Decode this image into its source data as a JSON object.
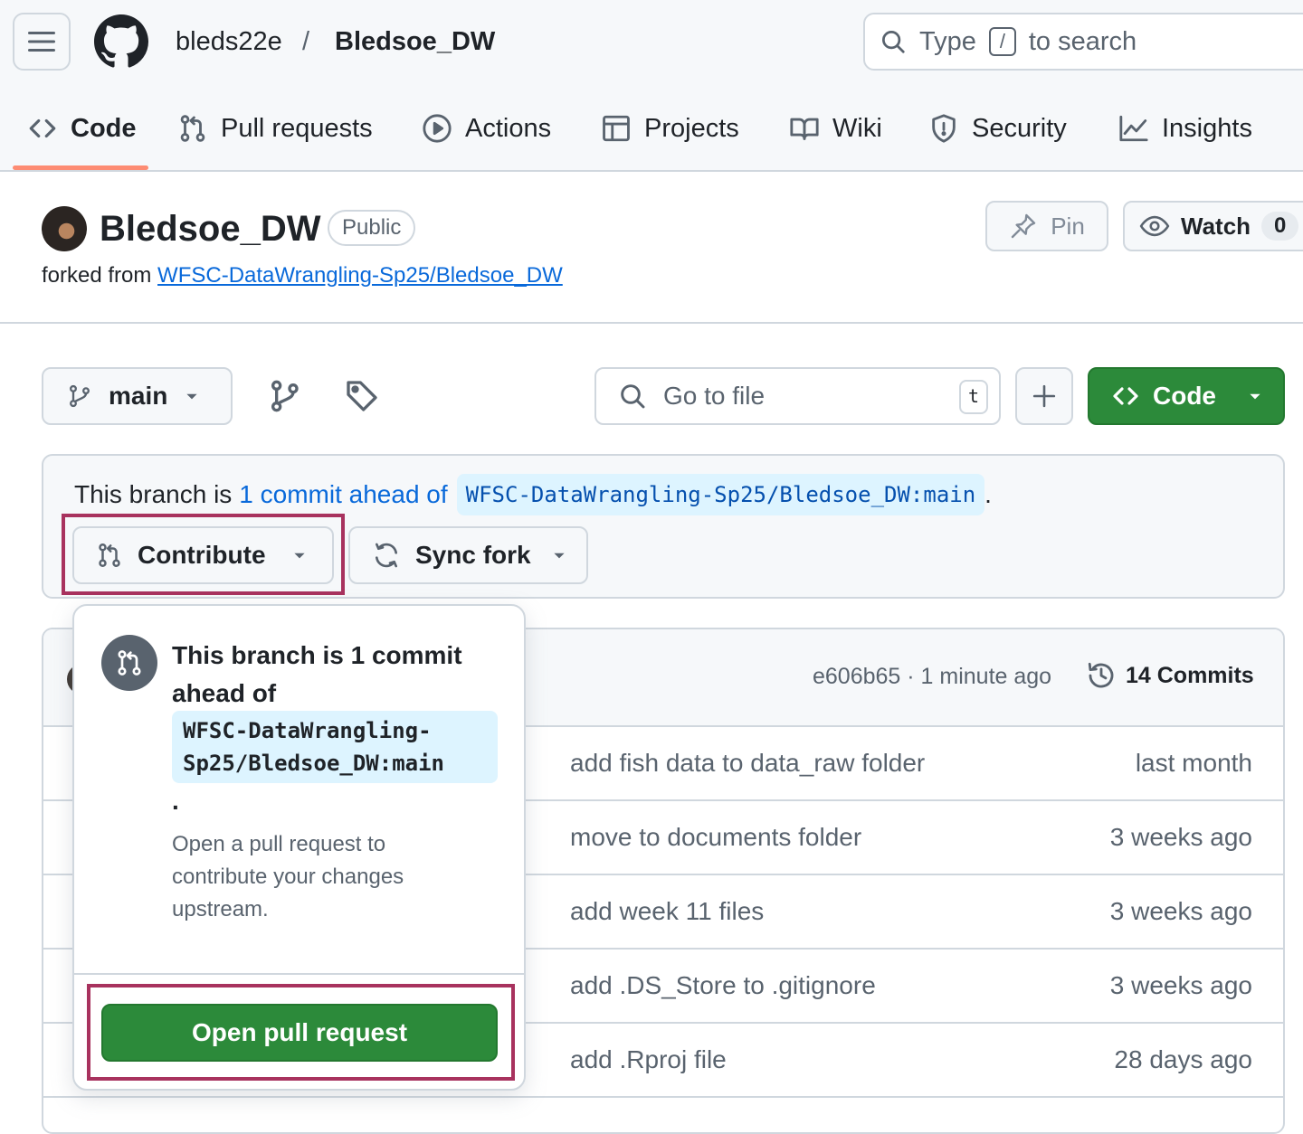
{
  "header": {
    "owner": "bleds22e",
    "separator": "/",
    "repo": "Bledsoe_DW",
    "search": {
      "before": "Type",
      "key": "/",
      "after": "to search"
    }
  },
  "tabs": [
    {
      "label": "Code",
      "icon": "code-icon",
      "active": true
    },
    {
      "label": "Pull requests",
      "icon": "git-pull-request-icon"
    },
    {
      "label": "Actions",
      "icon": "play-icon"
    },
    {
      "label": "Projects",
      "icon": "table-icon"
    },
    {
      "label": "Wiki",
      "icon": "book-icon"
    },
    {
      "label": "Security",
      "icon": "shield-icon"
    },
    {
      "label": "Insights",
      "icon": "graph-icon"
    }
  ],
  "repo": {
    "name": "Bledsoe_DW",
    "visibility": "Public",
    "forked_prefix": "forked from",
    "forked_from": "WFSC-DataWrangling-Sp25/Bledsoe_DW",
    "pin_label": "Pin",
    "watch_label": "Watch",
    "watch_count": "0"
  },
  "filenav": {
    "branch": "main",
    "goto_placeholder": "Go to file",
    "goto_key": "t",
    "code_label": "Code"
  },
  "banner": {
    "prefix": "This branch is",
    "link": "1 commit ahead of",
    "upstream": "WFSC-DataWrangling-Sp25/Bledsoe_DW:main",
    "suffix": ".",
    "contribute_label": "Contribute",
    "sync_label": "Sync fork"
  },
  "commits": {
    "meta": "e606b65 · 1 minute ago",
    "count": "14 Commits"
  },
  "files": [
    {
      "message": "add fish data to data_raw folder",
      "age": "last month"
    },
    {
      "message": "move to documents folder",
      "age": "3 weeks ago"
    },
    {
      "message": "add week 11 files",
      "age": "3 weeks ago"
    },
    {
      "message": "add .DS_Store to .gitignore",
      "age": "3 weeks ago"
    },
    {
      "message": "add .Rproj file",
      "age": "28 days ago"
    }
  ],
  "popover": {
    "title": "This branch is 1 commit ahead of",
    "upstream": "WFSC-DataWrangling-Sp25/Bledsoe_DW:main",
    "dot": ".",
    "description": "Open a pull request to contribute your changes upstream.",
    "button": "Open pull request"
  },
  "colors": {
    "primary_green": "#2c8a3a",
    "link_blue": "#0969da",
    "highlight_border": "#a8325e",
    "tab_underline": "#fd8c73"
  }
}
